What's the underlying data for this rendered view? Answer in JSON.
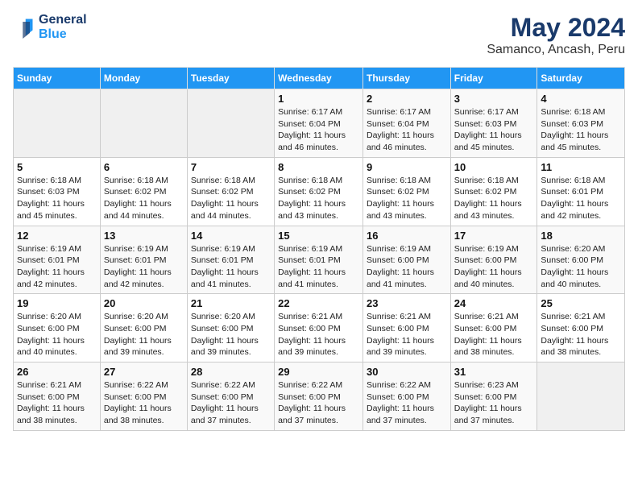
{
  "logo": {
    "line1": "General",
    "line2": "Blue"
  },
  "title": "May 2024",
  "subtitle": "Samanco, Ancash, Peru",
  "days_header": [
    "Sunday",
    "Monday",
    "Tuesday",
    "Wednesday",
    "Thursday",
    "Friday",
    "Saturday"
  ],
  "weeks": [
    [
      {
        "num": "",
        "info": ""
      },
      {
        "num": "",
        "info": ""
      },
      {
        "num": "",
        "info": ""
      },
      {
        "num": "1",
        "info": "Sunrise: 6:17 AM\nSunset: 6:04 PM\nDaylight: 11 hours\nand 46 minutes."
      },
      {
        "num": "2",
        "info": "Sunrise: 6:17 AM\nSunset: 6:04 PM\nDaylight: 11 hours\nand 46 minutes."
      },
      {
        "num": "3",
        "info": "Sunrise: 6:17 AM\nSunset: 6:03 PM\nDaylight: 11 hours\nand 45 minutes."
      },
      {
        "num": "4",
        "info": "Sunrise: 6:18 AM\nSunset: 6:03 PM\nDaylight: 11 hours\nand 45 minutes."
      }
    ],
    [
      {
        "num": "5",
        "info": "Sunrise: 6:18 AM\nSunset: 6:03 PM\nDaylight: 11 hours\nand 45 minutes."
      },
      {
        "num": "6",
        "info": "Sunrise: 6:18 AM\nSunset: 6:02 PM\nDaylight: 11 hours\nand 44 minutes."
      },
      {
        "num": "7",
        "info": "Sunrise: 6:18 AM\nSunset: 6:02 PM\nDaylight: 11 hours\nand 44 minutes."
      },
      {
        "num": "8",
        "info": "Sunrise: 6:18 AM\nSunset: 6:02 PM\nDaylight: 11 hours\nand 43 minutes."
      },
      {
        "num": "9",
        "info": "Sunrise: 6:18 AM\nSunset: 6:02 PM\nDaylight: 11 hours\nand 43 minutes."
      },
      {
        "num": "10",
        "info": "Sunrise: 6:18 AM\nSunset: 6:02 PM\nDaylight: 11 hours\nand 43 minutes."
      },
      {
        "num": "11",
        "info": "Sunrise: 6:18 AM\nSunset: 6:01 PM\nDaylight: 11 hours\nand 42 minutes."
      }
    ],
    [
      {
        "num": "12",
        "info": "Sunrise: 6:19 AM\nSunset: 6:01 PM\nDaylight: 11 hours\nand 42 minutes."
      },
      {
        "num": "13",
        "info": "Sunrise: 6:19 AM\nSunset: 6:01 PM\nDaylight: 11 hours\nand 42 minutes."
      },
      {
        "num": "14",
        "info": "Sunrise: 6:19 AM\nSunset: 6:01 PM\nDaylight: 11 hours\nand 41 minutes."
      },
      {
        "num": "15",
        "info": "Sunrise: 6:19 AM\nSunset: 6:01 PM\nDaylight: 11 hours\nand 41 minutes."
      },
      {
        "num": "16",
        "info": "Sunrise: 6:19 AM\nSunset: 6:00 PM\nDaylight: 11 hours\nand 41 minutes."
      },
      {
        "num": "17",
        "info": "Sunrise: 6:19 AM\nSunset: 6:00 PM\nDaylight: 11 hours\nand 40 minutes."
      },
      {
        "num": "18",
        "info": "Sunrise: 6:20 AM\nSunset: 6:00 PM\nDaylight: 11 hours\nand 40 minutes."
      }
    ],
    [
      {
        "num": "19",
        "info": "Sunrise: 6:20 AM\nSunset: 6:00 PM\nDaylight: 11 hours\nand 40 minutes."
      },
      {
        "num": "20",
        "info": "Sunrise: 6:20 AM\nSunset: 6:00 PM\nDaylight: 11 hours\nand 39 minutes."
      },
      {
        "num": "21",
        "info": "Sunrise: 6:20 AM\nSunset: 6:00 PM\nDaylight: 11 hours\nand 39 minutes."
      },
      {
        "num": "22",
        "info": "Sunrise: 6:21 AM\nSunset: 6:00 PM\nDaylight: 11 hours\nand 39 minutes."
      },
      {
        "num": "23",
        "info": "Sunrise: 6:21 AM\nSunset: 6:00 PM\nDaylight: 11 hours\nand 39 minutes."
      },
      {
        "num": "24",
        "info": "Sunrise: 6:21 AM\nSunset: 6:00 PM\nDaylight: 11 hours\nand 38 minutes."
      },
      {
        "num": "25",
        "info": "Sunrise: 6:21 AM\nSunset: 6:00 PM\nDaylight: 11 hours\nand 38 minutes."
      }
    ],
    [
      {
        "num": "26",
        "info": "Sunrise: 6:21 AM\nSunset: 6:00 PM\nDaylight: 11 hours\nand 38 minutes."
      },
      {
        "num": "27",
        "info": "Sunrise: 6:22 AM\nSunset: 6:00 PM\nDaylight: 11 hours\nand 38 minutes."
      },
      {
        "num": "28",
        "info": "Sunrise: 6:22 AM\nSunset: 6:00 PM\nDaylight: 11 hours\nand 37 minutes."
      },
      {
        "num": "29",
        "info": "Sunrise: 6:22 AM\nSunset: 6:00 PM\nDaylight: 11 hours\nand 37 minutes."
      },
      {
        "num": "30",
        "info": "Sunrise: 6:22 AM\nSunset: 6:00 PM\nDaylight: 11 hours\nand 37 minutes."
      },
      {
        "num": "31",
        "info": "Sunrise: 6:23 AM\nSunset: 6:00 PM\nDaylight: 11 hours\nand 37 minutes."
      },
      {
        "num": "",
        "info": ""
      }
    ]
  ]
}
